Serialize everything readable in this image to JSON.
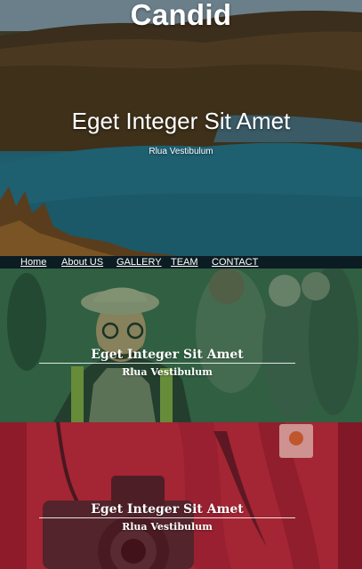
{
  "brand": "Candid",
  "hero": {
    "title": "Eget Integer Sit Amet",
    "subtitle": "Rlua Vestibulum"
  },
  "nav": {
    "items": [
      {
        "label": "Home"
      },
      {
        "label": "About US"
      },
      {
        "label": "GALLERY"
      },
      {
        "label": "TEAM"
      },
      {
        "label": "CONTACT"
      }
    ]
  },
  "panels": [
    {
      "title": "Eget Integer Sit Amet",
      "subtitle": "Rlua Vestibulum",
      "tint": "#1e6e3c"
    },
    {
      "title": "Eget Integer Sit Amet",
      "subtitle": "Rlua Vestibulum",
      "tint": "#be1432"
    }
  ],
  "colors": {
    "nav_bg": "#0b1c22",
    "text": "#ffffff"
  }
}
